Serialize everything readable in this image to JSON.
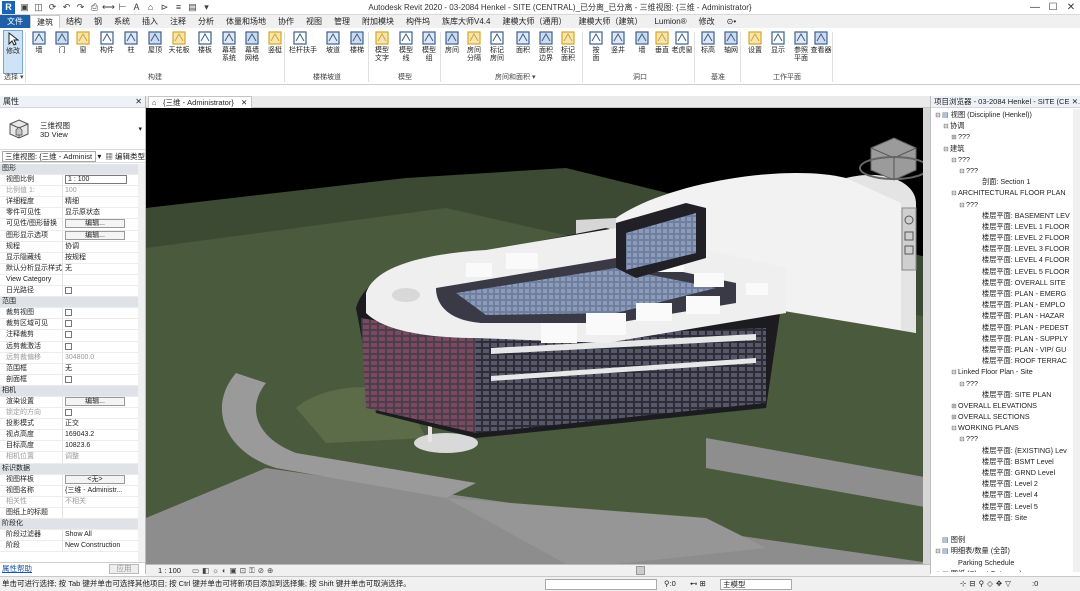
{
  "title_bar": {
    "title": "Autodesk Revit 2020 - 03-2084 Henkel - SITE (CENTRAL)_已分离_已分离 - 三维视图: {三维 - Administrator}",
    "app_logo": "R",
    "qat_icons": [
      "open-icon",
      "save-icon",
      "sync-icon",
      "undo-icon",
      "redo-icon",
      "print-icon",
      "measure-icon",
      "dimension-icon",
      "text-icon",
      "3d-view-icon",
      "section-icon",
      "thin-lines-icon",
      "close-hidden-icon",
      "switch-windows-icon"
    ]
  },
  "window_controls": {
    "minimize": "—",
    "maximize": "☐",
    "close": "✕"
  },
  "menu": {
    "tabs": [
      "文件",
      "建筑",
      "结构",
      "钢",
      "系统",
      "插入",
      "注释",
      "分析",
      "体量和场地",
      "协作",
      "视图",
      "管理",
      "附加模块",
      "构件坞",
      "族库大师V4.4",
      "建模大师（通用）",
      "建模大师（建筑）",
      "Lumion®",
      "修改",
      "⊙•"
    ],
    "active_index": 1
  },
  "ribbon": {
    "buttons": [
      {
        "label": "修改",
        "icon": "cursor-icon"
      },
      {
        "label": "墙",
        "icon": "wall-icon"
      },
      {
        "label": "门",
        "icon": "door-icon"
      },
      {
        "label": "窗",
        "icon": "window-icon"
      },
      {
        "label": "构件",
        "icon": "component-icon"
      },
      {
        "label": "柱",
        "icon": "column-icon"
      },
      {
        "label": "屋顶",
        "icon": "roof-icon"
      },
      {
        "label": "天花板",
        "icon": "ceiling-icon"
      },
      {
        "label": "楼板",
        "icon": "floor-icon"
      },
      {
        "label": "幕墙\n系统",
        "icon": "curtain-system-icon"
      },
      {
        "label": "幕墙\n网格",
        "icon": "curtain-grid-icon"
      },
      {
        "label": "竖梃",
        "icon": "mullion-icon"
      },
      {
        "label": "栏杆扶手",
        "icon": "railing-icon"
      },
      {
        "label": "坡道",
        "icon": "ramp-icon"
      },
      {
        "label": "楼梯",
        "icon": "stair-icon"
      },
      {
        "label": "模型\n文字",
        "icon": "model-text-icon"
      },
      {
        "label": "模型\n线",
        "icon": "model-line-icon"
      },
      {
        "label": "模型\n组",
        "icon": "model-group-icon"
      },
      {
        "label": "房间",
        "icon": "room-icon"
      },
      {
        "label": "房间\n分隔",
        "icon": "room-separator-icon"
      },
      {
        "label": "标记\n房间",
        "icon": "tag-room-icon"
      },
      {
        "label": "面积",
        "icon": "area-icon"
      },
      {
        "label": "面积\n边界",
        "icon": "area-boundary-icon"
      },
      {
        "label": "标记\n面积",
        "icon": "tag-area-icon"
      },
      {
        "label": "按\n面",
        "icon": "by-face-icon"
      },
      {
        "label": "竖井",
        "icon": "shaft-icon"
      },
      {
        "label": "墙",
        "icon": "wall-opening-icon"
      },
      {
        "label": "垂直",
        "icon": "vertical-opening-icon"
      },
      {
        "label": "老虎窗",
        "icon": "dormer-icon"
      },
      {
        "label": "标高",
        "icon": "level-icon"
      },
      {
        "label": "轴网",
        "icon": "grid-icon"
      },
      {
        "label": "设置",
        "icon": "set-workplane-icon"
      },
      {
        "label": "显示",
        "icon": "show-workplane-icon"
      },
      {
        "label": "参照\n平面",
        "icon": "ref-plane-icon"
      },
      {
        "label": "查看器",
        "icon": "viewer-icon"
      }
    ],
    "panels": [
      "选择 ▾",
      "构建",
      "楼梯坡道",
      "模型",
      "房间和面积 ▾",
      "洞口",
      "基准",
      "工作平面"
    ]
  },
  "properties": {
    "header": "属性",
    "type_line1": "三维视图",
    "type_line2": "3D View",
    "instance_selector": "三维视图: {三维 - Administ",
    "edit_type": "编辑类型",
    "rows": [
      {
        "kind": "section",
        "k": "图形"
      },
      {
        "k": "视图比例",
        "v": "1 : 100",
        "style": "input"
      },
      {
        "k": "比例值 1:",
        "v": "100",
        "dim": true
      },
      {
        "k": "详细程度",
        "v": "精细"
      },
      {
        "k": "零件可见性",
        "v": "显示原状态"
      },
      {
        "k": "可见性/图形替换",
        "v": "编辑...",
        "style": "button"
      },
      {
        "k": "图形显示选项",
        "v": "编辑...",
        "style": "button"
      },
      {
        "k": "规程",
        "v": "协调"
      },
      {
        "k": "显示隐藏线",
        "v": "按规程"
      },
      {
        "k": "默认分析显示样式",
        "v": "无"
      },
      {
        "k": "View Category",
        "v": ""
      },
      {
        "k": "日光路径",
        "v": "",
        "style": "check"
      },
      {
        "kind": "section",
        "k": "范围"
      },
      {
        "k": "裁剪视图",
        "v": "",
        "style": "check"
      },
      {
        "k": "裁剪区域可见",
        "v": "",
        "style": "check"
      },
      {
        "k": "注释裁剪",
        "v": "",
        "style": "check"
      },
      {
        "k": "远剪裁激活",
        "v": "",
        "style": "check"
      },
      {
        "k": "远剪裁偏移",
        "v": "304800.0",
        "dim": true
      },
      {
        "k": "范围框",
        "v": "无"
      },
      {
        "k": "剖面框",
        "v": "",
        "style": "check"
      },
      {
        "kind": "section",
        "k": "相机"
      },
      {
        "k": "渲染设置",
        "v": "编辑...",
        "style": "button"
      },
      {
        "k": "锁定的方向",
        "v": "",
        "style": "check",
        "dim": true
      },
      {
        "k": "投影模式",
        "v": "正交"
      },
      {
        "k": "视点高度",
        "v": "169043.2"
      },
      {
        "k": "目标高度",
        "v": "10823.6"
      },
      {
        "k": "相机位置",
        "v": "调整",
        "dim": true
      },
      {
        "kind": "section",
        "k": "标识数据"
      },
      {
        "k": "视图样板",
        "v": "<无>",
        "style": "button"
      },
      {
        "k": "视图名称",
        "v": "{三维 - Administr..."
      },
      {
        "k": "相关性",
        "v": "不相关",
        "dim": true
      },
      {
        "k": "图纸上的标题",
        "v": ""
      },
      {
        "kind": "section",
        "k": "阶段化"
      },
      {
        "k": "阶段过滤器",
        "v": "Show All"
      },
      {
        "k": "阶段",
        "v": "New Construction"
      }
    ],
    "help_link": "属性帮助",
    "apply": "应用"
  },
  "view": {
    "tab_label": "{三维 - Administrator}",
    "scale": "1 : 100"
  },
  "browser": {
    "header": "项目浏览器 - 03-2084 Henkel - SITE (CEN...",
    "nodes": [
      {
        "t": "⊟",
        "text": "视图 (Discipline (Henkel))",
        "indent": 0,
        "icon": "views-icon"
      },
      {
        "t": "⊟",
        "text": "协调",
        "indent": 1
      },
      {
        "t": "⊞",
        "text": "???",
        "indent": 2
      },
      {
        "t": "⊟",
        "text": "建筑",
        "indent": 1
      },
      {
        "t": "⊟",
        "text": "???",
        "indent": 2
      },
      {
        "t": "⊟",
        "text": "???",
        "indent": 3
      },
      {
        "t": "",
        "text": "剖面: Section 1",
        "indent": 5
      },
      {
        "t": "⊟",
        "text": "ARCHITECTURAL FLOOR PLAN",
        "indent": 2
      },
      {
        "t": "⊟",
        "text": "???",
        "indent": 3
      },
      {
        "t": "",
        "text": "楼层平面: BASEMENT LEV",
        "indent": 5
      },
      {
        "t": "",
        "text": "楼层平面: LEVEL 1 FLOOR",
        "indent": 5
      },
      {
        "t": "",
        "text": "楼层平面: LEVEL 2 FLOOR",
        "indent": 5
      },
      {
        "t": "",
        "text": "楼层平面: LEVEL 3 FLOOR",
        "indent": 5
      },
      {
        "t": "",
        "text": "楼层平面: LEVEL 4 FLOOR",
        "indent": 5
      },
      {
        "t": "",
        "text": "楼层平面: LEVEL 5 FLOOR",
        "indent": 5
      },
      {
        "t": "",
        "text": "楼层平面: OVERALL SITE",
        "indent": 5
      },
      {
        "t": "",
        "text": "楼层平面: PLAN - EMERG",
        "indent": 5
      },
      {
        "t": "",
        "text": "楼层平面: PLAN - EMPLO",
        "indent": 5
      },
      {
        "t": "",
        "text": "楼层平面: PLAN - HAZAR",
        "indent": 5
      },
      {
        "t": "",
        "text": "楼层平面: PLAN - PEDEST",
        "indent": 5
      },
      {
        "t": "",
        "text": "楼层平面: PLAN - SUPPLY",
        "indent": 5
      },
      {
        "t": "",
        "text": "楼层平面: PLAN - VIP/ GU",
        "indent": 5
      },
      {
        "t": "",
        "text": "楼层平面: ROOF TERRAC",
        "indent": 5
      },
      {
        "t": "⊟",
        "text": "Linked Floor Plan - Site",
        "indent": 2
      },
      {
        "t": "⊟",
        "text": "???",
        "indent": 3
      },
      {
        "t": "",
        "text": "楼层平面: SITE PLAN",
        "indent": 5
      },
      {
        "t": "⊞",
        "text": "OVERALL ELEVATIONS",
        "indent": 2
      },
      {
        "t": "⊞",
        "text": "OVERALL SECTIONS",
        "indent": 2
      },
      {
        "t": "⊟",
        "text": "WORKING PLANS",
        "indent": 2
      },
      {
        "t": "⊟",
        "text": "???",
        "indent": 3
      },
      {
        "t": "",
        "text": "楼层平面: {EXISTING} Lev",
        "indent": 5
      },
      {
        "t": "",
        "text": "楼层平面: BSMT Level",
        "indent": 5
      },
      {
        "t": "",
        "text": "楼层平面: GRND Level",
        "indent": 5
      },
      {
        "t": "",
        "text": "楼层平面: Level 2",
        "indent": 5
      },
      {
        "t": "",
        "text": "楼层平面: Level 4",
        "indent": 5
      },
      {
        "t": "",
        "text": "楼层平面: Level 5",
        "indent": 5
      },
      {
        "t": "",
        "text": "楼层平面: Site",
        "indent": 5
      },
      {
        "t": "",
        "text": "",
        "indent": 0
      },
      {
        "t": "",
        "text": "图例",
        "indent": 0,
        "icon": "legend-icon"
      },
      {
        "t": "⊟",
        "text": "明细表/数量 (全部)",
        "indent": 0,
        "icon": "schedule-icon"
      },
      {
        "t": "",
        "text": "Parking Schedule",
        "indent": 2
      },
      {
        "t": "⊞",
        "text": "图纸 (Sheet Category)",
        "indent": 0,
        "icon": "sheet-icon"
      }
    ]
  },
  "status": {
    "message": "单击可进行选择; 按 Tab 键并单击可选择其他项目; 按 Ctrl 键并单击可将新项目添加到选择集; 按 Shift 键并单击可取消选择。",
    "zero1": ":0",
    "model": "主模型",
    "zero2": ":0"
  }
}
